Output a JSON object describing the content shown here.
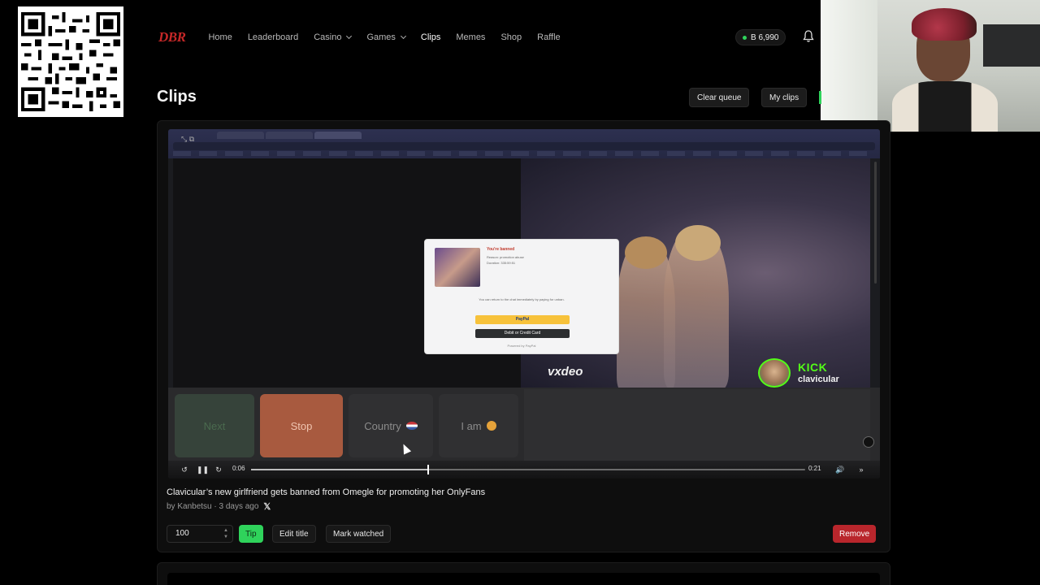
{
  "nav": {
    "logo": "DBR",
    "items": [
      {
        "label": "Home",
        "active": false,
        "dropdown": false
      },
      {
        "label": "Leaderboard",
        "active": false,
        "dropdown": false
      },
      {
        "label": "Casino",
        "active": false,
        "dropdown": true
      },
      {
        "label": "Games",
        "active": false,
        "dropdown": true
      },
      {
        "label": "Clips",
        "active": true,
        "dropdown": false
      },
      {
        "label": "Memes",
        "active": false,
        "dropdown": false
      },
      {
        "label": "Shop",
        "active": false,
        "dropdown": false
      },
      {
        "label": "Raffle",
        "active": false,
        "dropdown": false
      }
    ],
    "balance": "B 6,990",
    "bell_icon": "bell-icon"
  },
  "page": {
    "title": "Clips",
    "clear_queue_label": "Clear queue",
    "my_clips_label": "My clips"
  },
  "video": {
    "popup": {
      "title": "You're banned",
      "reason_line": "Reason: promotion abuse",
      "duration_line": "Duration: 335:59:51",
      "message": "You can return to the chat immediately by paying for unban.",
      "paypal_label": "PayPal",
      "card_label": "Debit or Credit Card",
      "powered_by": "Powered by PayPal"
    },
    "watermark": "vxdeo",
    "kick_logo": "KICK",
    "kick_user": "clavicular",
    "buttons": {
      "next": "Next",
      "stop": "Stop",
      "country": "Country",
      "iam": "I am"
    },
    "player": {
      "current_time": "0:06",
      "duration": "0:21",
      "progress": 0.32
    }
  },
  "clip": {
    "title": "Clavicular’s new girlfriend gets banned from Omegle for promoting her OnlyFans",
    "author_line": "by Kanbetsu · 3 days ago",
    "x_icon": "x-logo-icon"
  },
  "actions": {
    "amount_value": "100",
    "tip_label": "Tip",
    "edit_title_label": "Edit title",
    "mark_watched_label": "Mark watched",
    "remove_label": "Remove"
  },
  "colors": {
    "accent_green": "#2fd35b",
    "danger_red": "#b9262c",
    "logo_red": "#c62828",
    "kick_green": "#53fc18"
  }
}
